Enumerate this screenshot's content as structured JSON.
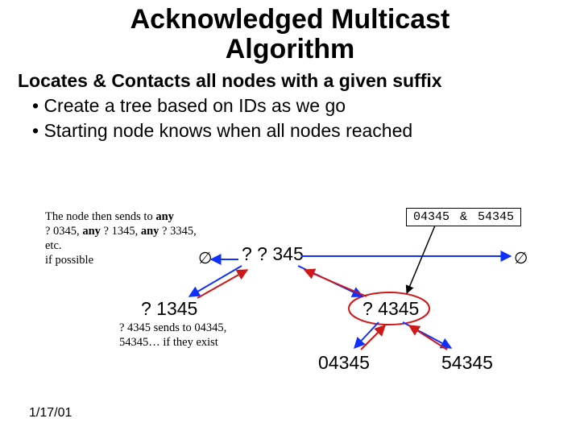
{
  "title_line1": "Acknowledged Multicast",
  "title_line2": "Algorithm",
  "subtitle": "Locates & Contacts all nodes with a given suffix",
  "bullets": {
    "b1": "• Create a tree based on IDs as we go",
    "b2": "• Starting node knows when all nodes reached"
  },
  "note1": {
    "l1a": "The node then sends to ",
    "l1b": "any",
    "l2a": "? 0345, ",
    "l2b": "any ",
    "l2c": "? 1345, ",
    "l2d": "any ",
    "l2e": "? 3345, etc.",
    "l3": "if possible"
  },
  "note2": {
    "l1": "? 4345 sends to 04345,",
    "l2": "54345… if they exist"
  },
  "box4": "04345 & 54345",
  "nodes": {
    "root": "? ? 345",
    "left": "? 1345",
    "right": "? 4345",
    "rl": "04345",
    "rr": "54345"
  },
  "empty": "∅",
  "footer": "1/17/01"
}
